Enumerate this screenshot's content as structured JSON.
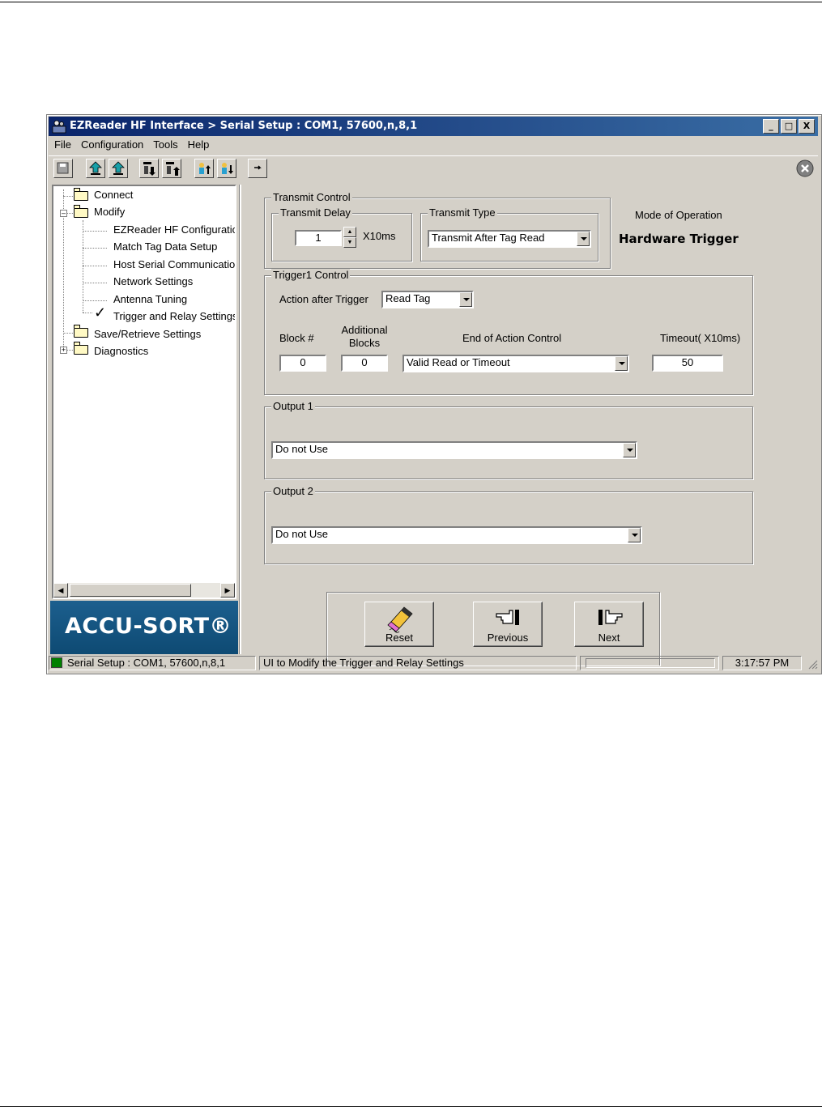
{
  "window": {
    "title": "EZReader HF Interface > Serial Setup : COM1, 57600,n,8,1",
    "minimize": "_",
    "maximize": "□",
    "close": "X"
  },
  "menu": [
    "File",
    "Configuration",
    "Tools",
    "Help"
  ],
  "toolbar": {
    "icons": [
      "save-icon",
      "upload-icon",
      "upload-icon",
      "download-icon",
      "download-icon",
      "user-upload-icon",
      "user-download-icon",
      "pointer-icon",
      "close-circle-icon"
    ]
  },
  "tree": {
    "connect": "Connect",
    "modify": "Modify",
    "children": [
      "EZReader HF Configuratio",
      "Match Tag Data Setup",
      "Host Serial Communication",
      "Network Settings",
      "Antenna Tuning",
      "Trigger and Relay Settings"
    ],
    "checkmark": "✓",
    "save_retrieve": "Save/Retrieve Settings",
    "diagnostics": "Diagnostics"
  },
  "logo": {
    "text": "ACCU-SORT®"
  },
  "transmit_control": {
    "title": "Transmit Control",
    "delay_title": "Transmit Delay",
    "delay_value": "1",
    "delay_unit": "X10ms",
    "type_title": "Transmit Type",
    "type_value": "Transmit After Tag Read"
  },
  "mode": {
    "label": "Mode of Operation",
    "value": "Hardware Trigger"
  },
  "trigger1": {
    "title": "Trigger1 Control",
    "action_label": "Action after Trigger",
    "action_value": "Read Tag",
    "block_label": "Block #",
    "additional_label_1": "Additional",
    "additional_label_2": "Blocks",
    "end_action_label": "End of Action Control",
    "timeout_label": "Timeout( X10ms)",
    "block_value": "0",
    "additional_value": "0",
    "end_action_value": "Valid Read or Timeout",
    "timeout_value": "50"
  },
  "output1": {
    "title": "Output 1",
    "value": "Do not Use"
  },
  "output2": {
    "title": "Output 2",
    "value": "Do not Use"
  },
  "buttons": {
    "reset": "Reset",
    "previous": "Previous",
    "next": "Next"
  },
  "status": {
    "connection": "Serial Setup : COM1, 57600,n,8,1",
    "message": "UI to Modify the Trigger and Relay Settings",
    "time": "3:17:57 PM",
    "indicator_color": "#008000"
  }
}
